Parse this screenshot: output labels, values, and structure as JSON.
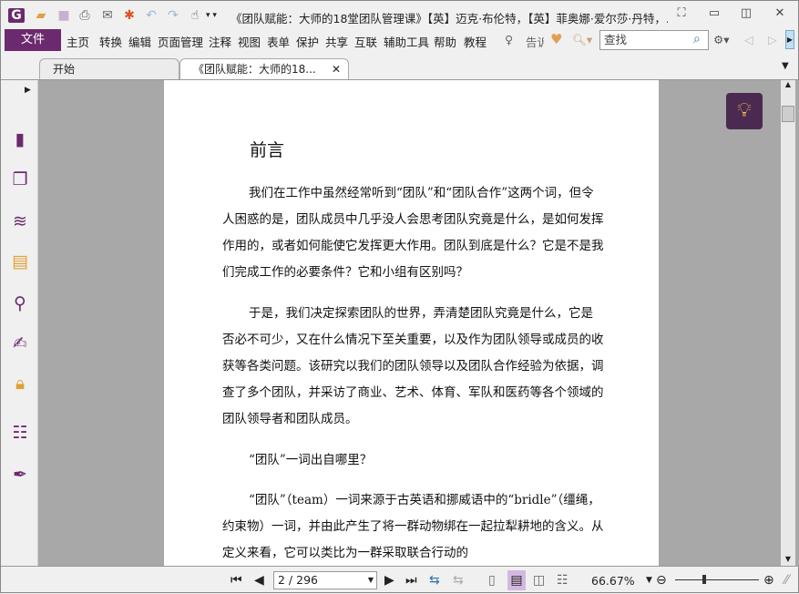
{
  "window": {
    "title": "《团队赋能：大师的18堂团队管理课》【英】迈克·布伦特，【英】菲奥娜·爱尔莎·丹特，..."
  },
  "menu": {
    "file": "文件",
    "items": [
      "主页",
      "转换",
      "编辑",
      "页面管理",
      "注释",
      "视图",
      "表单",
      "保护",
      "共享",
      "互联",
      "辅助工具",
      "帮助",
      "教程"
    ],
    "tell_me": "告诉",
    "search_placeholder": "查找"
  },
  "tabs": [
    {
      "label": "开始"
    },
    {
      "label": "《团队赋能：大师的18..."
    }
  ],
  "document": {
    "heading": "前言",
    "paragraphs": [
      "我们在工作中虽然经常听到“团队”和“团队合作”这两个词，但令人困惑的是，团队成员中几乎没人会思考团队究竟是什么，是如何发挥作用的，或者如何能使它发挥更大作用。团队到底是什么？它是不是我们完成工作的必要条件？它和小组有区别吗？",
      "于是，我们决定探索团队的世界，弄清楚团队究竟是什么，它是否必不可少，又在什么情况下至关重要，以及作为团队领导或成员的收获等各类问题。该研究以我们的团队领导以及团队合作经验为依据，调查了多个团队，并采访了商业、艺术、体育、军队和医药等各个领域的团队领导者和团队成员。",
      "“团队”一词出自哪里？",
      "“团队”（team）一词来源于古英语和挪威语中的“bridle”（缰绳，约束物）一词，并由此产生了将一群动物绑在一起拉犁耕地的含义。从定义来看，它可以类比为一群采取联合行动的"
    ]
  },
  "statusbar": {
    "page": "2 / 296",
    "zoom": "66.67%"
  },
  "colors": {
    "brand": "#6b2a6e"
  }
}
